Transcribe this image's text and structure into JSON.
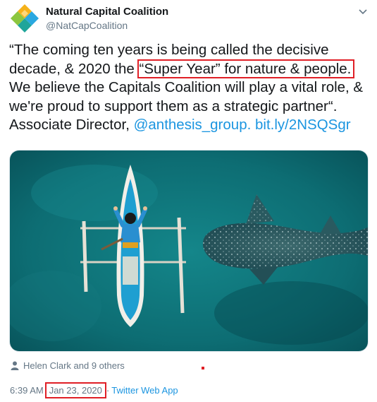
{
  "account": {
    "name": "Natural Capital Coalition",
    "handle": "@NatCapCoalition",
    "logo_colors": [
      "#f5b21a",
      "#8cc63f",
      "#2aa8e0",
      "#1fa59a"
    ]
  },
  "tweet": {
    "text_part1": "“The coming ten years is being called the decisive decade, & 2020 the ",
    "highlight": "“Super Year” for nature & people.",
    "text_part2": " We believe the Capitals Coalition will play a vital role, & we're proud to support them as a strategic partner“. Associate Director, ",
    "mention": "@anthesis_group.",
    "link": "bit.ly/2NSQSgr"
  },
  "media": {
    "description_icon": "photo-boat-whale-shark"
  },
  "likes": {
    "text": "Helen Clark and 9 others"
  },
  "meta": {
    "time": "6:39 AM",
    "separator": "·",
    "date": "Jan 23, 2020",
    "source": "Twitter Web App"
  },
  "colors": {
    "link": "#1b95e0",
    "annotation": "#e01f26",
    "sea": "#0f6f76"
  }
}
